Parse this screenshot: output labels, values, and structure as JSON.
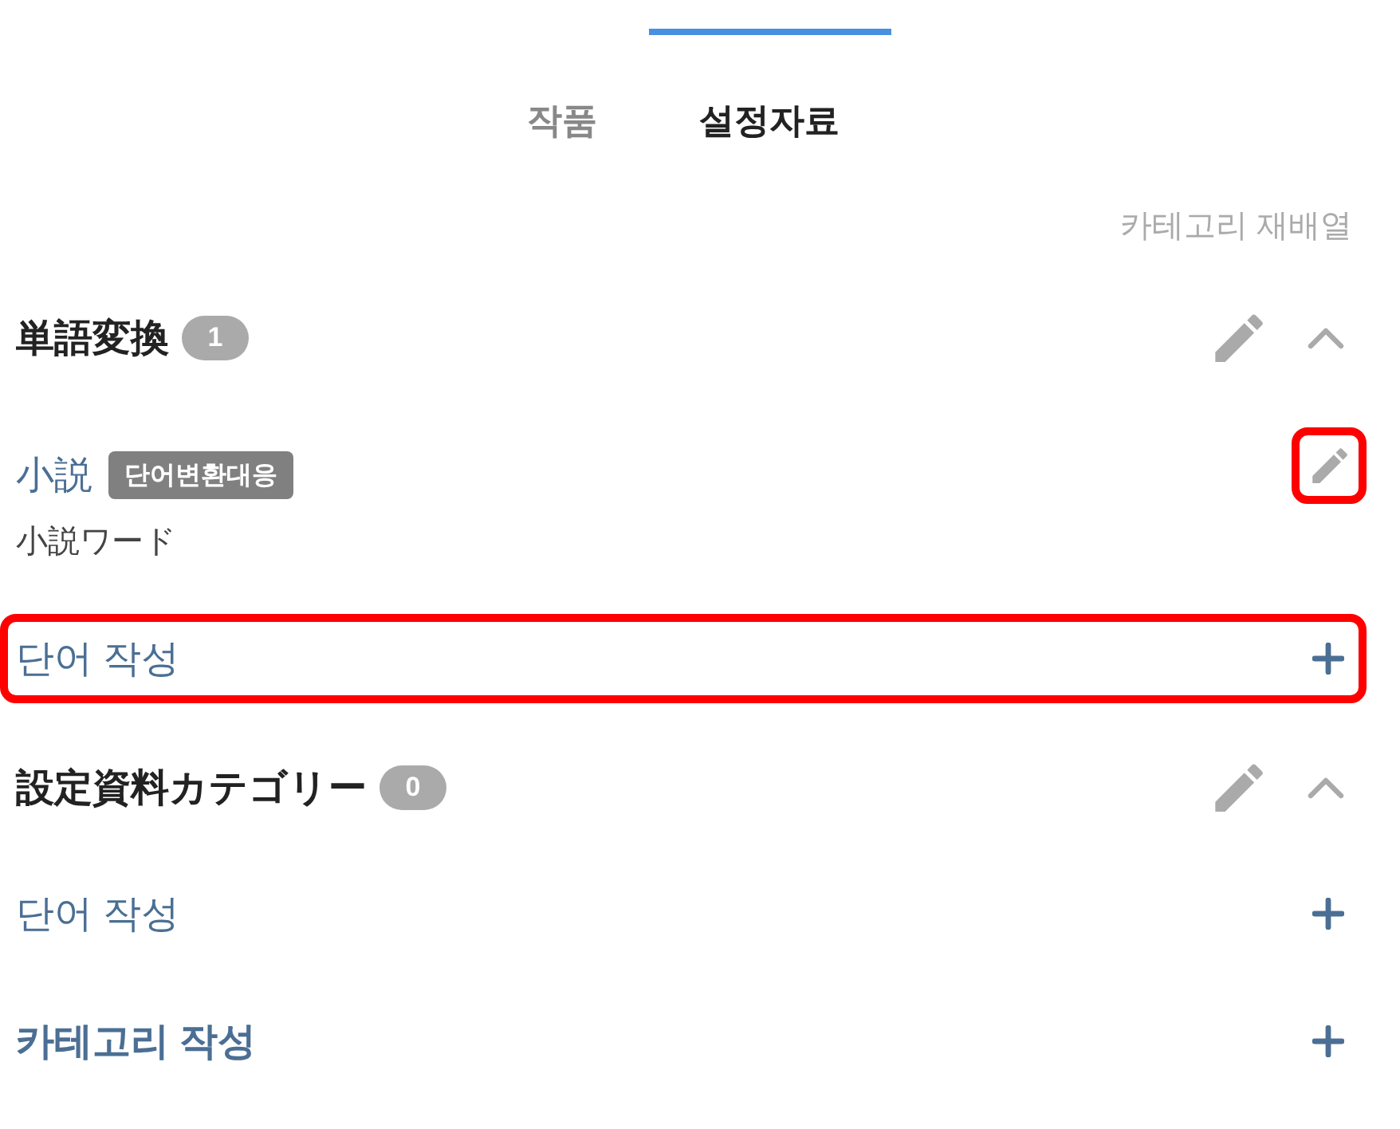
{
  "tabs": [
    {
      "label": "작품",
      "selected": false
    },
    {
      "label": "설정자료",
      "selected": true
    }
  ],
  "reorder_link": "카테고리 재배열",
  "sections": [
    {
      "title": "単語変換",
      "count": "1",
      "expanded": true,
      "items": [
        {
          "name": "小説",
          "tag": "단어변환대응",
          "subtitle": "小説ワード",
          "edit_highlighted": true
        }
      ],
      "add_word": {
        "label": "단어 작성",
        "highlighted": true
      }
    },
    {
      "title": "設定資料カテゴリー",
      "count": "0",
      "expanded": true,
      "add_word": {
        "label": "단어 작성",
        "highlighted": false
      }
    }
  ],
  "add_category": {
    "label": "카테고리 작성"
  }
}
